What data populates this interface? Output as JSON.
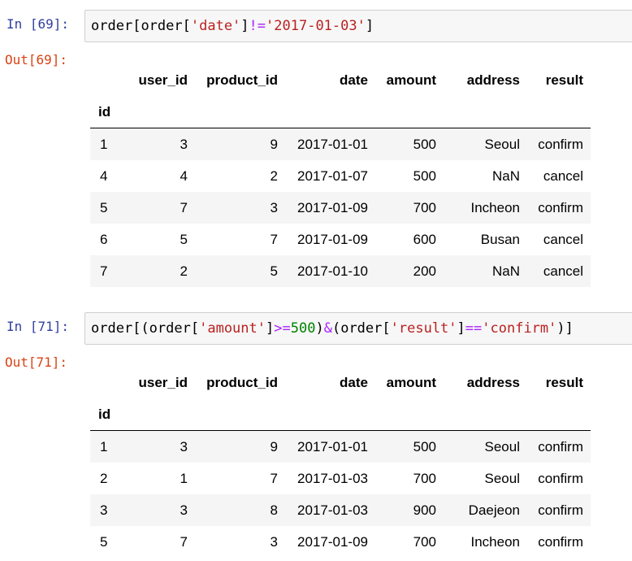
{
  "cells": [
    {
      "in_prompt": "In [69]:",
      "out_prompt": "Out[69]:",
      "code": {
        "t1": "order",
        "t2": "[",
        "t3": "order",
        "t4": "[",
        "t5": "'date'",
        "t6": "]",
        "t7": "!=",
        "t8": "'2017-01-03'",
        "t9": "]"
      },
      "columns": [
        "user_id",
        "product_id",
        "date",
        "amount",
        "address",
        "result"
      ],
      "index_name": "id",
      "rows": [
        {
          "id": "1",
          "user_id": "3",
          "product_id": "9",
          "date": "2017-01-01",
          "amount": "500",
          "address": "Seoul",
          "result": "confirm"
        },
        {
          "id": "4",
          "user_id": "4",
          "product_id": "2",
          "date": "2017-01-07",
          "amount": "500",
          "address": "NaN",
          "result": "cancel"
        },
        {
          "id": "5",
          "user_id": "7",
          "product_id": "3",
          "date": "2017-01-09",
          "amount": "700",
          "address": "Incheon",
          "result": "confirm"
        },
        {
          "id": "6",
          "user_id": "5",
          "product_id": "7",
          "date": "2017-01-09",
          "amount": "600",
          "address": "Busan",
          "result": "cancel"
        },
        {
          "id": "7",
          "user_id": "2",
          "product_id": "5",
          "date": "2017-01-10",
          "amount": "200",
          "address": "NaN",
          "result": "cancel"
        }
      ]
    },
    {
      "in_prompt": "In [71]:",
      "out_prompt": "Out[71]:",
      "code": {
        "t1": "order",
        "t2": "[(",
        "t3": "order",
        "t4": "[",
        "t5": "'amount'",
        "t6": "]",
        "t7": ">=",
        "t8": "500",
        "t9": ")",
        "t10": "&",
        "t11": "(",
        "t12": "order",
        "t13": "[",
        "t14": "'result'",
        "t15": "]",
        "t16": "==",
        "t17": "'confirm'",
        "t18": ")]"
      },
      "columns": [
        "user_id",
        "product_id",
        "date",
        "amount",
        "address",
        "result"
      ],
      "index_name": "id",
      "rows": [
        {
          "id": "1",
          "user_id": "3",
          "product_id": "9",
          "date": "2017-01-01",
          "amount": "500",
          "address": "Seoul",
          "result": "confirm"
        },
        {
          "id": "2",
          "user_id": "1",
          "product_id": "7",
          "date": "2017-01-03",
          "amount": "700",
          "address": "Seoul",
          "result": "confirm"
        },
        {
          "id": "3",
          "user_id": "3",
          "product_id": "8",
          "date": "2017-01-03",
          "amount": "900",
          "address": "Daejeon",
          "result": "confirm"
        },
        {
          "id": "5",
          "user_id": "7",
          "product_id": "3",
          "date": "2017-01-09",
          "amount": "700",
          "address": "Incheon",
          "result": "confirm"
        }
      ]
    }
  ]
}
